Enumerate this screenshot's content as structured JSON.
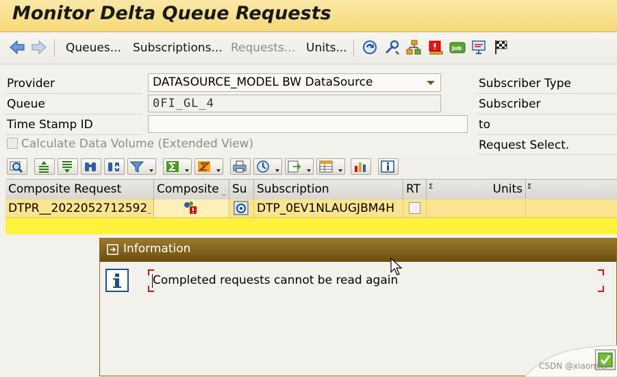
{
  "title_bar": {
    "title": "Monitor Delta Queue Requests"
  },
  "toolbar": {
    "back_icon": "back-arrow-icon",
    "forward_icon": "forward-arrow-icon",
    "queues_label": "Queues...",
    "subscriptions_label": "Subscriptions...",
    "requests_label": "Requests...",
    "units_label": "Units...",
    "icons": [
      "refresh-icon",
      "tools-icon",
      "hierarchy-icon",
      "alert-icon",
      "job-icon",
      "monitor-icon",
      "checkered-flag-icon"
    ]
  },
  "form": {
    "provider_label": "Provider",
    "provider_value": "DATASOURCE_MODEL BW DataSource",
    "queue_label": "Queue",
    "queue_value": "0FI_GL_4",
    "timestamp_label": "Time Stamp ID",
    "timestamp_value": "",
    "calc_volume_label": "Calculate Data Volume (Extended View)",
    "calc_volume_checked": false,
    "subscriber_type_label": "Subscriber Type",
    "subscriber_label": "Subscriber",
    "to_label": "to",
    "request_select_label": "Request Select."
  },
  "grid": {
    "columns": [
      "Composite Request",
      "Composite",
      "Su",
      "Subscription",
      "RT",
      "Units"
    ],
    "rows": [
      {
        "composite_request": "DTPR__2022052712592",
        "composite_icon": "status-error-icon",
        "su_icon": "subscription-icon",
        "subscription": "DTP_0EV1NLAUGJBM4H",
        "rt": false,
        "units": ""
      }
    ]
  },
  "dialog": {
    "title": "Information",
    "message": "Completed requests cannot be read again",
    "confirm_icon": "checkmark-icon"
  },
  "watermark": "CSDN @xiaomici",
  "colors": {
    "title_bar": "#f6d977",
    "dialog_header": "#7a5a17",
    "selected_row": "#fbe48f",
    "highlight_row": "#fff23d"
  }
}
